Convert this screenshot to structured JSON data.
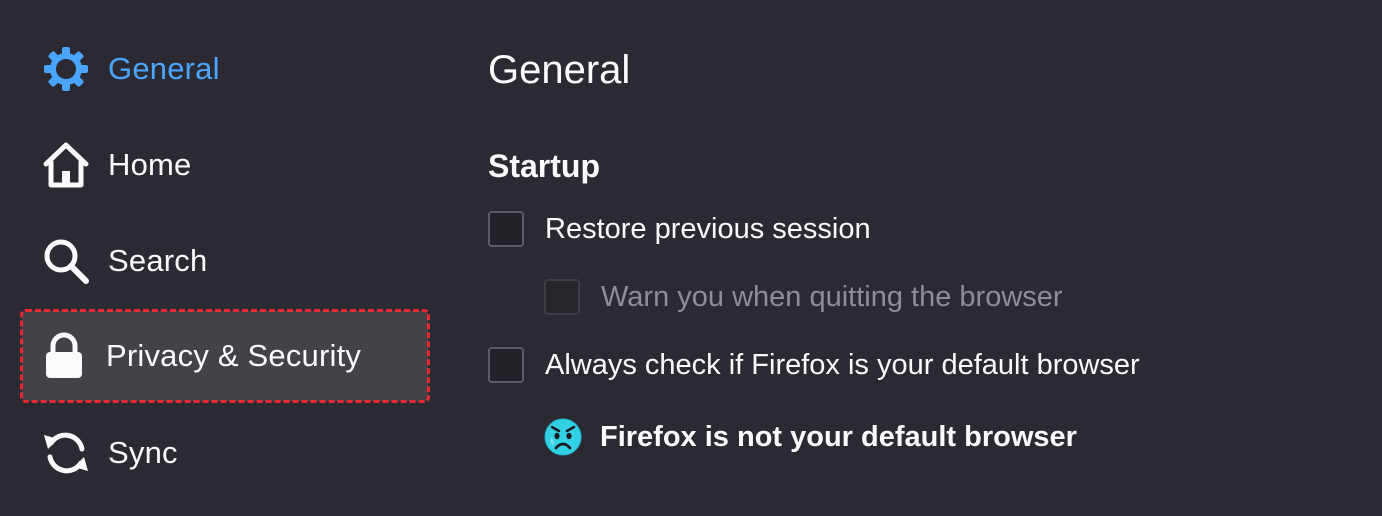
{
  "sidebar": {
    "items": [
      {
        "label": "General",
        "icon": "gear-icon",
        "selected": true
      },
      {
        "label": "Home",
        "icon": "home-icon"
      },
      {
        "label": "Search",
        "icon": "search-icon"
      },
      {
        "label": "Privacy & Security",
        "icon": "lock-icon",
        "highlighted": true
      },
      {
        "label": "Sync",
        "icon": "sync-icon"
      }
    ]
  },
  "main": {
    "title": "General",
    "startup": {
      "heading": "Startup",
      "options": [
        {
          "label": "Restore previous session",
          "checked": false,
          "disabled": false
        },
        {
          "label": "Warn you when quitting the browser",
          "checked": false,
          "disabled": true
        },
        {
          "label": "Always check if Firefox is your default browser",
          "checked": false,
          "disabled": false
        }
      ],
      "notice": {
        "text": "Firefox is not your default browser",
        "icon": "sad-face-icon"
      }
    }
  },
  "colors": {
    "background": "#2b2a33",
    "accent": "#4aa5ff",
    "highlight_border": "#e8282e",
    "notice_icon": "#54ffbd"
  }
}
